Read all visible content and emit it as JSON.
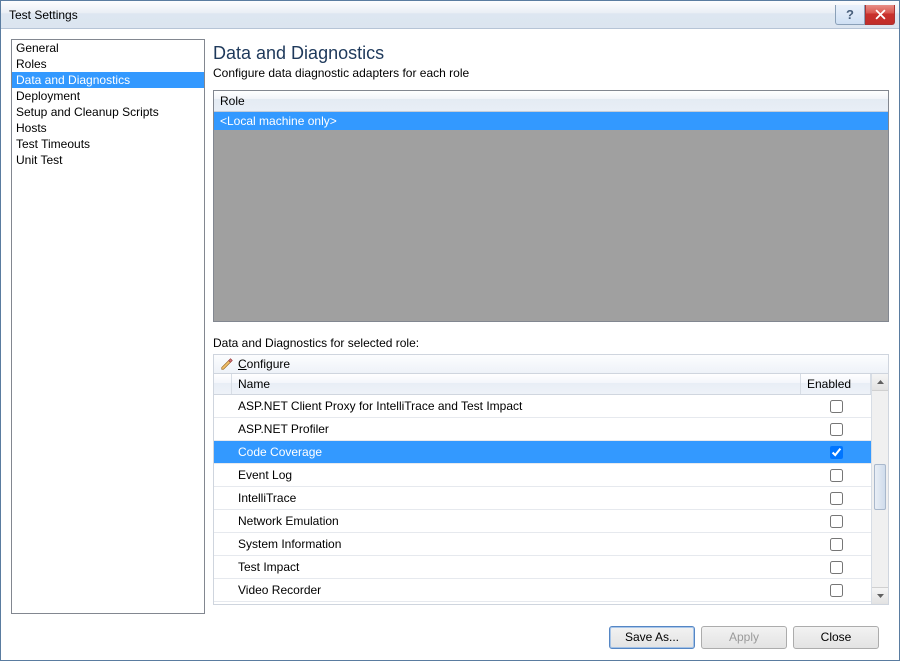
{
  "window": {
    "title": "Test Settings"
  },
  "nav": {
    "items": [
      {
        "label": "General"
      },
      {
        "label": "Roles"
      },
      {
        "label": "Data and Diagnostics",
        "selected": true
      },
      {
        "label": "Deployment"
      },
      {
        "label": "Setup and Cleanup Scripts"
      },
      {
        "label": "Hosts"
      },
      {
        "label": "Test Timeouts"
      },
      {
        "label": "Unit Test"
      }
    ]
  },
  "main": {
    "title": "Data and Diagnostics",
    "subtitle": "Configure data diagnostic adapters for each role",
    "role_header": "Role",
    "role_selected": "<Local machine only>",
    "section_label": "Data and Diagnostics for selected role:",
    "configure_label": "Configure",
    "columns": {
      "name": "Name",
      "enabled": "Enabled"
    },
    "adapters": [
      {
        "name": "ASP.NET Client Proxy for IntelliTrace and Test Impact",
        "enabled": false
      },
      {
        "name": "ASP.NET Profiler",
        "enabled": false
      },
      {
        "name": "Code Coverage",
        "enabled": true,
        "selected": true
      },
      {
        "name": "Event Log",
        "enabled": false
      },
      {
        "name": "IntelliTrace",
        "enabled": false
      },
      {
        "name": "Network Emulation",
        "enabled": false
      },
      {
        "name": "System Information",
        "enabled": false
      },
      {
        "name": "Test Impact",
        "enabled": false
      },
      {
        "name": "Video Recorder",
        "enabled": false
      }
    ]
  },
  "footer": {
    "save_as": "Save As...",
    "apply": "Apply",
    "close": "Close",
    "apply_enabled": false
  }
}
